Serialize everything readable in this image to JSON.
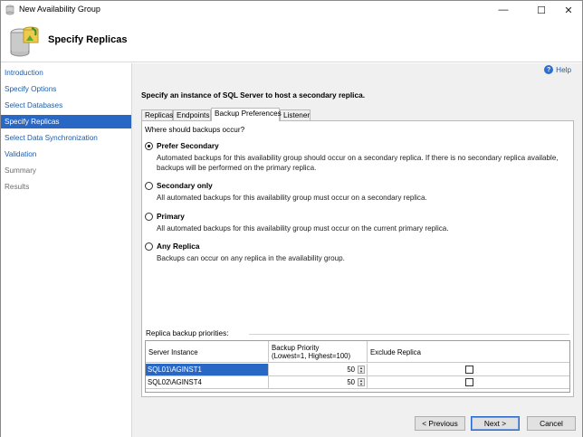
{
  "window": {
    "title": "New Availability Group",
    "controls": {
      "minimize": "—",
      "maximize": "☐",
      "close": "✕"
    }
  },
  "header": {
    "title": "Specify Replicas",
    "icon": "database-wizard-icon"
  },
  "nav": {
    "items": [
      {
        "label": "Introduction",
        "state": "link"
      },
      {
        "label": "Specify Options",
        "state": "link"
      },
      {
        "label": "Select Databases",
        "state": "link"
      },
      {
        "label": "Specify Replicas",
        "state": "active"
      },
      {
        "label": "Select Data Synchronization",
        "state": "link"
      },
      {
        "label": "Validation",
        "state": "link"
      },
      {
        "label": "Summary",
        "state": "disabled"
      },
      {
        "label": "Results",
        "state": "disabled"
      }
    ]
  },
  "main": {
    "help_label": "Help",
    "instruction": "Specify an instance of SQL Server to host a secondary replica.",
    "tabs": [
      {
        "label": "Replicas",
        "active": false
      },
      {
        "label": "Endpoints",
        "active": false
      },
      {
        "label": "Backup Preferences",
        "active": true
      },
      {
        "label": "Listener",
        "active": false
      }
    ],
    "backup": {
      "question": "Where should backups occur?",
      "options": [
        {
          "label": "Prefer Secondary",
          "checked": true,
          "description": "Automated backups for this availability group should occur on a secondary replica. If there is no secondary replica available, backups will be performed on the primary replica."
        },
        {
          "label": "Secondary only",
          "checked": false,
          "description": "All automated backups for this availability group must occur on a secondary replica."
        },
        {
          "label": "Primary",
          "checked": false,
          "description": "All automated backups for this availability group must occur on the current primary replica."
        },
        {
          "label": "Any Replica",
          "checked": false,
          "description": "Backups can occur on any replica in the availability group."
        }
      ],
      "priorities_label": "Replica backup priorities:",
      "grid": {
        "columns": [
          "Server Instance",
          "Backup Priority",
          "(Lowest=1, Highest=100)",
          "Exclude Replica"
        ],
        "rows": [
          {
            "server": "SQL01\\AGINST1",
            "priority": "50",
            "exclude": false,
            "selected": true
          },
          {
            "server": "SQL02\\AGINST4",
            "priority": "50",
            "exclude": false,
            "selected": false
          }
        ]
      }
    }
  },
  "footer": {
    "previous": "< Previous",
    "next": "Next >",
    "cancel": "Cancel"
  },
  "colors": {
    "accent": "#2967c5",
    "link": "#1e5ca8",
    "panel_bg": "#f0f0f0"
  }
}
